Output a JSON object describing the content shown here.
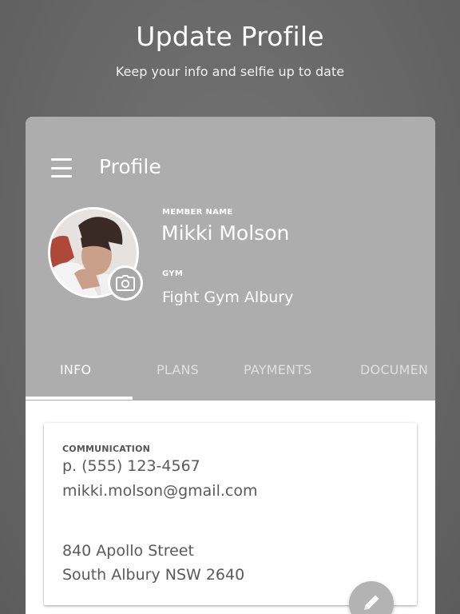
{
  "promo": {
    "headline": "Update Profile",
    "subline": "Keep your info and selfie up to date"
  },
  "app": {
    "screen_title": "Profile",
    "header_color": "#adadad",
    "member": {
      "name_label": "MEMBER NAME",
      "name": "Mikki Molson",
      "gym_label": "GYM",
      "gym": "Fight Gym Albury"
    },
    "icons": {
      "menu": "hamburger-menu-icon",
      "camera": "camera-icon",
      "edit": "pencil-icon"
    },
    "tabs": [
      {
        "label": "INFO",
        "active": true
      },
      {
        "label": "PLANS",
        "active": false
      },
      {
        "label": "PAYMENTS",
        "active": false
      },
      {
        "label": "DOCUMEN",
        "active": false
      }
    ],
    "communication": {
      "label": "COMMUNICATION",
      "phone": "p. (555) 123-4567",
      "email": "mikki.molson@gmail.com",
      "address_line1": "840 Apollo Street",
      "address_line2": "South Albury NSW 2640"
    }
  }
}
